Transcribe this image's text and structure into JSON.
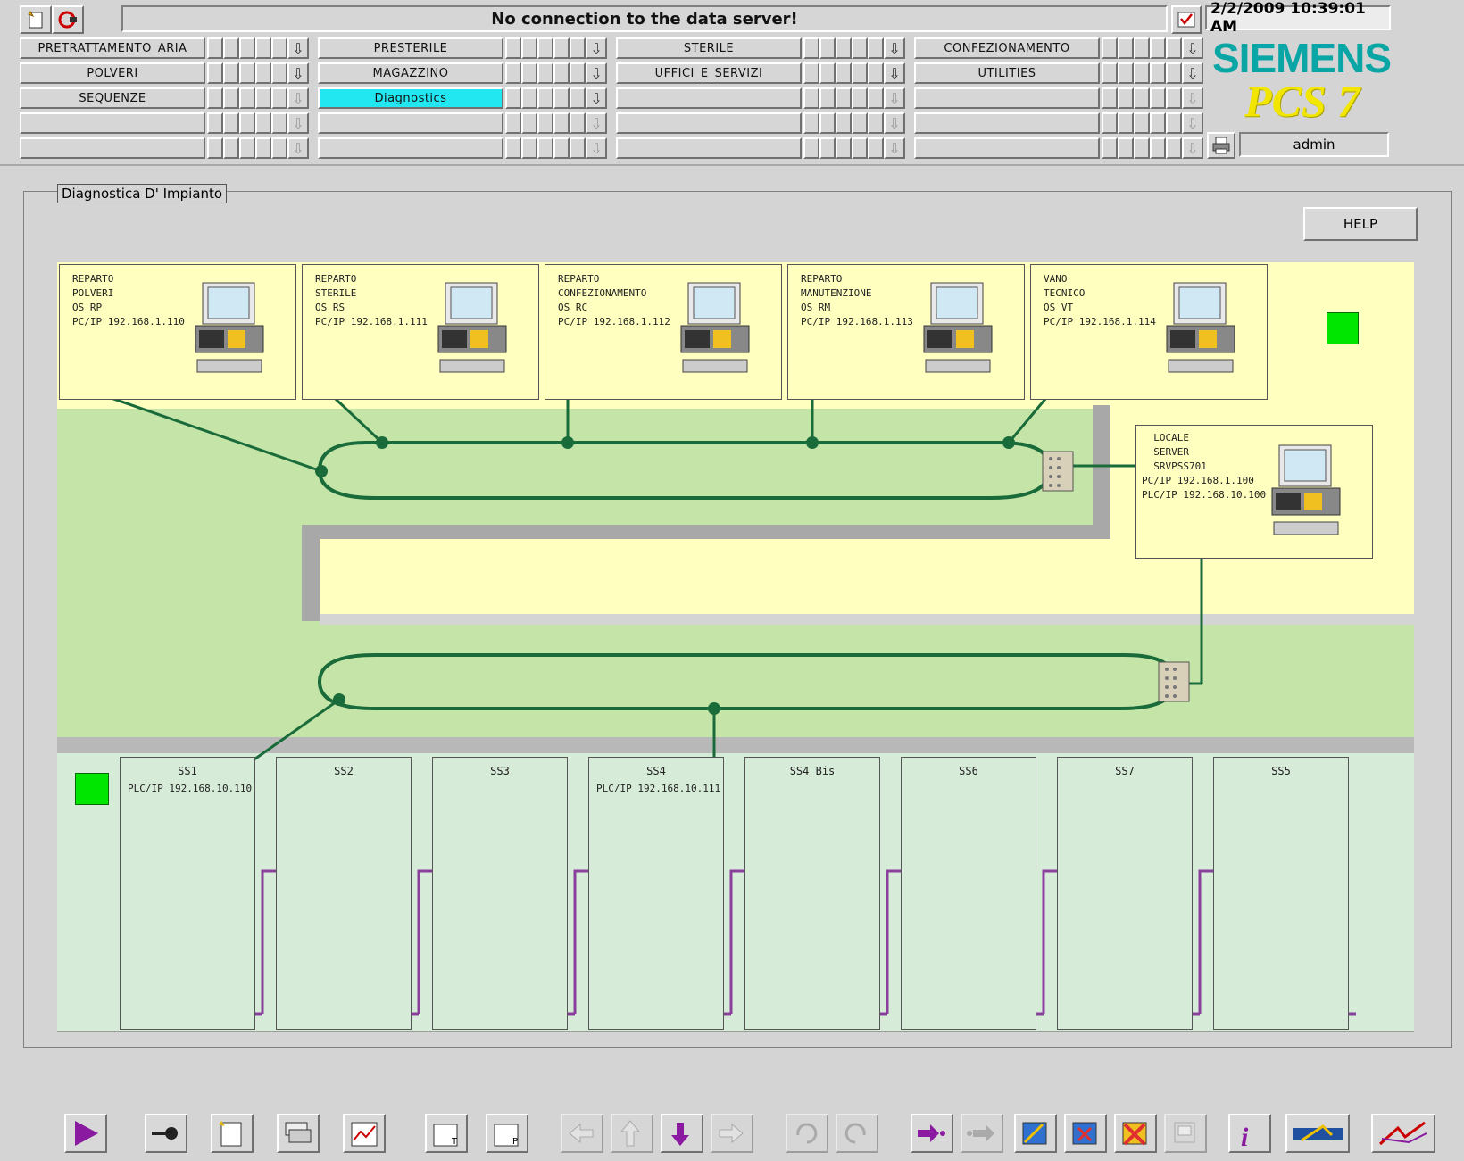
{
  "header": {
    "status_message": "No connection to the data server!",
    "datetime": "2/2/2009 10:39:01 AM",
    "brand": "SIEMENS",
    "product": "PCS 7",
    "user": "admin",
    "rows": [
      [
        "PRETRATTAMENTO_ARIA",
        "PRESTERILE",
        "STERILE",
        "CONFEZIONAMENTO"
      ],
      [
        "POLVERI",
        "MAGAZZINO",
        "UFFICI_E_SERVIZI",
        "UTILITIES"
      ],
      [
        "SEQUENZE",
        "Diagnostics",
        "",
        ""
      ],
      [
        "",
        "",
        "",
        ""
      ],
      [
        "",
        "",
        "",
        ""
      ]
    ],
    "active_area": "Diagnostics"
  },
  "panel": {
    "title": "Diagnostica D' Impianto",
    "help_label": "HELP",
    "stations_os": [
      {
        "lines": "REPARTO\nPOLVERI\nOS RP\nPC/IP 192.168.1.110"
      },
      {
        "lines": "REPARTO\nSTERILE\nOS RS\nPC/IP 192.168.1.111"
      },
      {
        "lines": "REPARTO\nCONFEZIONAMENTO\nOS RC\nPC/IP 192.168.1.112"
      },
      {
        "lines": "REPARTO\nMANUTENZIONE\nOS RM\nPC/IP 192.168.1.113"
      },
      {
        "lines": "VANO\nTECNICO\nOS VT\nPC/IP 192.168.1.114"
      }
    ],
    "server": {
      "lines": "  LOCALE\n  SERVER\n  SRVPSS701\nPC/IP 192.168.1.100\nPLC/IP 192.168.10.100"
    },
    "plc_stations": [
      {
        "name": "SS1",
        "ip": "PLC/IP 192.168.10.110"
      },
      {
        "name": "SS2",
        "ip": ""
      },
      {
        "name": "SS3",
        "ip": ""
      },
      {
        "name": "SS4",
        "ip": "PLC/IP 192.168.10.111"
      },
      {
        "name": "SS4 Bis",
        "ip": ""
      },
      {
        "name": "SS6",
        "ip": ""
      },
      {
        "name": "SS7",
        "ip": ""
      },
      {
        "name": "SS5",
        "ip": ""
      }
    ],
    "status_color_ok": "#00e600"
  },
  "colors": {
    "network_green": "#1a6b3a",
    "profibus_purple": "#8a3f9c",
    "active_area": "#22e6f0",
    "os_area": "#ffffc0",
    "net_area": "#c4e4a8",
    "plc_area": "#d6ecd8"
  }
}
